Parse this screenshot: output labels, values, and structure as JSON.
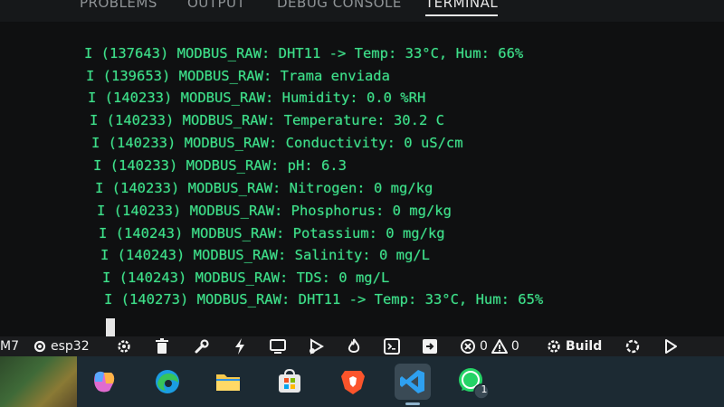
{
  "panel": {
    "tabs": [
      {
        "label": "PROBLEMS",
        "active": false
      },
      {
        "label": "OUTPUT",
        "active": false
      },
      {
        "label": "DEBUG CONSOLE",
        "active": false
      },
      {
        "label": "TERMINAL",
        "active": true
      }
    ]
  },
  "terminal": {
    "lines": [
      "I (137643) MODBUS_RAW: DHT11 -> Temp: 33°C, Hum: 66%",
      "I (139653) MODBUS_RAW: Trama enviada",
      "I (140233) MODBUS_RAW: Humidity: 0.0 %RH",
      "I (140233) MODBUS_RAW: Temperature: 30.2 C",
      "I (140233) MODBUS_RAW: Conductivity: 0 uS/cm",
      "I (140233) MODBUS_RAW: pH: 6.3",
      "I (140233) MODBUS_RAW: Nitrogen: 0 mg/kg",
      "I (140233) MODBUS_RAW: Phosphorus: 0 mg/kg",
      "I (140243) MODBUS_RAW: Potassium: 0 mg/kg",
      "I (140243) MODBUS_RAW: Salinity: 0 mg/L",
      "I (140243) MODBUS_RAW: TDS: 0 mg/L",
      "I (140273) MODBUS_RAW: DHT11 -> Temp: 33°C, Hum: 65%"
    ],
    "text_color": "#3ee08a"
  },
  "statusbar": {
    "left_fragment": "M7",
    "target_label": "esp32",
    "errors": "0",
    "warnings": "0",
    "build_label": "Build",
    "icons": [
      "chip-icon",
      "gear-icon",
      "trash-icon",
      "wrench-icon",
      "flash-icon",
      "monitor-icon",
      "debug-icon",
      "flame-icon",
      "terminal-icon",
      "extension-icon",
      "error-icon",
      "warning-icon",
      "build-gear-icon",
      "spinner-icon",
      "run-icon"
    ]
  },
  "taskbar": {
    "apps": [
      {
        "name": "copilot",
        "active": false
      },
      {
        "name": "edge",
        "active": false
      },
      {
        "name": "file-explorer",
        "active": false
      },
      {
        "name": "microsoft-store",
        "active": false
      },
      {
        "name": "brave",
        "active": false
      },
      {
        "name": "vscode",
        "active": true
      },
      {
        "name": "whatsapp",
        "active": false,
        "badge": "1"
      }
    ]
  },
  "colors": {
    "terminal_bg": "#0f1011",
    "statusbar_bg": "#1b1c1e",
    "taskbar_bg": "#1c2a33"
  }
}
